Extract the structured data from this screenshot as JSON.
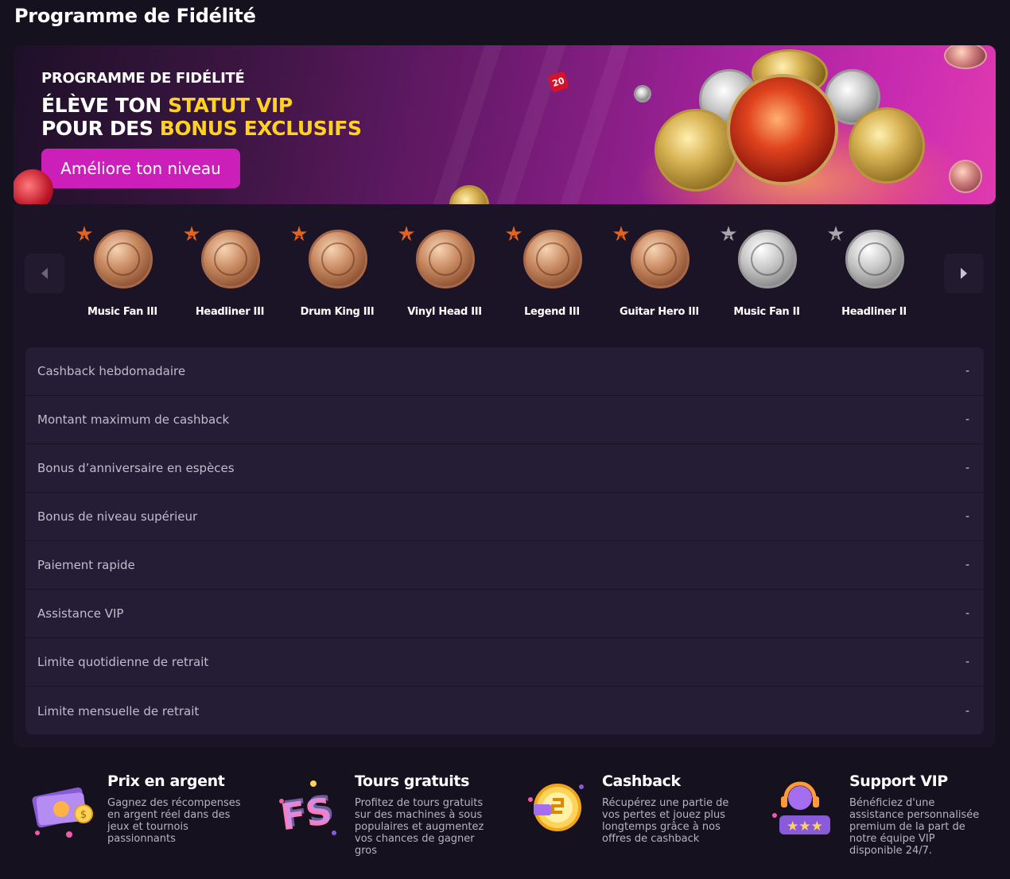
{
  "page": {
    "title": "Programme de Fidélité"
  },
  "hero": {
    "eyebrow": "PROGRAMME DE FIDÉLITÉ",
    "line1_plain": "ÉLÈVE TON",
    "line1_accent": "STATUT VIP",
    "line2_plain": "POUR DES",
    "line2_accent": "BONUS EXCLUSIFS",
    "cta_label": "Améliore ton niveau",
    "badge_number": "20",
    "accent_color": "#ffd21e",
    "cta_color": "#cc1fb9"
  },
  "tiers": {
    "prev_icon": "chevron-left-icon",
    "next_icon": "chevron-right-icon",
    "items": [
      {
        "number": "1",
        "name": "Music Fan III",
        "metal": "bronze"
      },
      {
        "number": "2",
        "name": "Headliner III",
        "metal": "bronze"
      },
      {
        "number": "3",
        "name": "Drum King III",
        "metal": "bronze"
      },
      {
        "number": "4",
        "name": "Vinyl Head III",
        "metal": "bronze"
      },
      {
        "number": "5",
        "name": "Legend III",
        "metal": "bronze"
      },
      {
        "number": "6",
        "name": "Guitar Hero III",
        "metal": "bronze"
      },
      {
        "number": "7",
        "name": "Music Fan II",
        "metal": "silver"
      },
      {
        "number": "8",
        "name": "Headliner II",
        "metal": "silver"
      }
    ]
  },
  "benefits": [
    {
      "label": "Cashback hebdomadaire",
      "value": "-"
    },
    {
      "label": "Montant maximum de cashback",
      "value": "-"
    },
    {
      "label": "Bonus d’anniversaire en espèces",
      "value": "-"
    },
    {
      "label": "Bonus de niveau supérieur",
      "value": "-"
    },
    {
      "label": "Paiement rapide",
      "value": "-"
    },
    {
      "label": "Assistance VIP",
      "value": "-"
    },
    {
      "label": "Limite quotidienne de retrait",
      "value": "-"
    },
    {
      "label": "Limite mensuelle de retrait",
      "value": "-"
    }
  ],
  "features": [
    {
      "icon": "cash-money-icon",
      "title": "Prix en argent",
      "description": "Gagnez des récompenses en argent réel dans des jeux et tournois passionnants"
    },
    {
      "icon": "free-spins-icon",
      "title": "Tours gratuits",
      "description": "Profitez de tours gratuits sur des machines à sous populaires et augmentez vos chances de gagner gros"
    },
    {
      "icon": "cashback-coin-icon",
      "title": "Cashback",
      "description": "Récupérez une partie de vos pertes et jouez plus longtemps grâce à nos offres de cashback"
    },
    {
      "icon": "vip-support-headset-icon",
      "title": "Support VIP",
      "description": "Bénéficiez d'une assistance personnalisée premium de la part de notre équipe VIP disponible 24/7."
    }
  ]
}
